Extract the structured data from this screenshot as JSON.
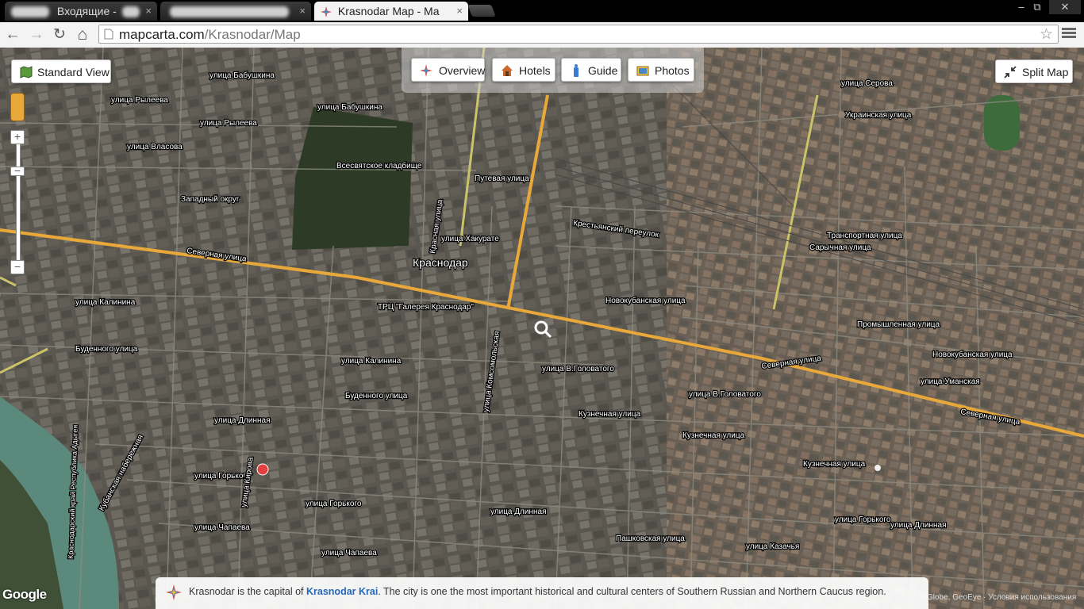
{
  "browser": {
    "tabs": [
      {
        "title": "Входящие -",
        "active": false
      },
      {
        "title": "",
        "active": false
      },
      {
        "title": "Krasnodar Map - Ma",
        "active": true
      }
    ],
    "close_glyph": "×",
    "window_controls": {
      "minimize": "–",
      "maximize": "⧉",
      "close": "✕"
    },
    "nav": {
      "back": "←",
      "forward": "→",
      "reload": "↻",
      "home": "⌂"
    },
    "url_host": "mapcarta.com",
    "url_path": "/Krasnodar/Map",
    "bookmark_icon": "☆"
  },
  "map_controls": {
    "standard_view": "Standard View",
    "split_map": "Split Map",
    "zoom_in": "+",
    "zoom_out": "−",
    "nav_tabs": [
      {
        "label": "Overview",
        "icon": "compass-icon"
      },
      {
        "label": "Hotels",
        "icon": "house-icon"
      },
      {
        "label": "Guide",
        "icon": "guide-icon"
      },
      {
        "label": "Photos",
        "icon": "photos-icon"
      }
    ]
  },
  "map_labels": {
    "city": "Краснодар",
    "cemetery": "Всесвятское кладбище",
    "district": "Западный округ",
    "mall": "ТРЦ \"Галерея Краснодар\"",
    "severnaya": "Северная улица",
    "severnaya2": "Северная улица",
    "severnaya3": "Северная улица",
    "kalinina": "улица Калинина",
    "kalinina2": "улица Калинина",
    "budennogo": "Буденного улица",
    "budennogo2": "Буденного улица",
    "golovatogo": "улица В.Головатого",
    "golovatogo2": "улица В.Головатого",
    "gorkogo": "улица Горького",
    "gorkogo2": "улица Горького",
    "gorkogo3": "улица Горького",
    "dlinnaya": "улица Длинная",
    "dlinnaya2": "улица Длинная",
    "dlinnaya3": "улица Длинная",
    "chapaeva": "улица Чапаева",
    "chapaeva2": "улица Чапаева",
    "kuznechnaya": "Кузнечная улица",
    "kuznechnaya2": "Кузнечная улица",
    "kuznechnaya3": "Кузнечная улица",
    "putevaya": "Путевая улица",
    "hakurate": "улица Хакурате",
    "krestyansky": "Крестьянский переулок",
    "novokubanskaya": "Новокубанская улица",
    "novokubanskaya2": "Новокубанская улица",
    "transportnaya": "Транспортная улица",
    "sarichnaya": "Сарычная улица",
    "promyshlennaya": "Промышленная улица",
    "serova": "улица Серова",
    "ukrainskaya": "Украинская улица",
    "babushkina": "улица Бабушкина",
    "babushkina2": "улица Бабушкина",
    "ryleeva": "улица Рылеева",
    "ryleeva2": "улица Рылеева",
    "vlasova": "улица Власова",
    "komsomolskaya": "улица Комсомольская",
    "krasnaya": "Красная улица",
    "kirova": "улица Кирова",
    "umanskaya": "улица Уманская",
    "kazachya": "улица Казачья",
    "pashkovskaya": "Пашковская улица",
    "naberezhnaya": "Кубанская набережная",
    "adygea": "Краснодарский край Республика Адыгея"
  },
  "google_logo": "Google",
  "attribution": "Globe, GeoEye · Условия использования",
  "info": {
    "text_before": "Krasnodar is the capital of ",
    "link": "Krasnodar Krai",
    "text_after": ". The city is one the most important historical and cultural centers of Southern Russian and Northern Caucus region."
  },
  "colors": {
    "road_major": "#e8a83a",
    "road_minor": "#c9c36a",
    "river": "#5b8a7c"
  }
}
